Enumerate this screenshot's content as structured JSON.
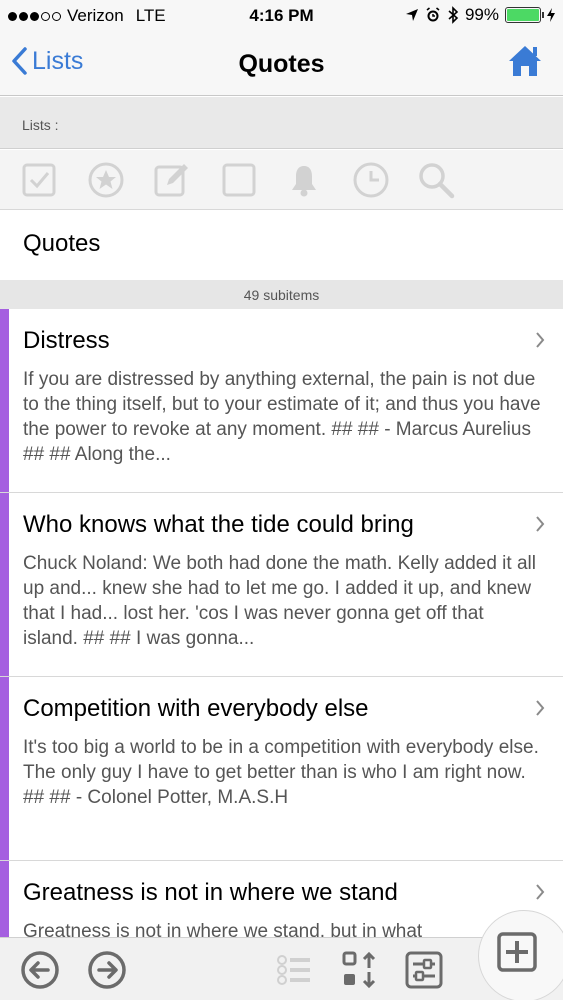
{
  "status_bar": {
    "carrier": "Verizon",
    "network": "LTE",
    "time": "4:16 PM",
    "battery_percent": "99%",
    "battery_level": 0.99
  },
  "nav": {
    "back_label": "Lists",
    "title": "Quotes"
  },
  "breadcrumb": {
    "label": "Lists :"
  },
  "toolbar": {
    "icons": [
      "checkbox-checked-icon",
      "star-circle-icon",
      "edit-icon",
      "checkbox-empty-icon",
      "bell-icon",
      "clock-icon",
      "search-icon"
    ]
  },
  "list": {
    "title": "Quotes",
    "subitems_count": "49 subitems"
  },
  "items": [
    {
      "title": "Distress",
      "description": "If you are distressed by anything external, the pain is not due to the thing itself, but to your estimate of it; and thus you have the power to revoke at any moment.  ##  ## - Marcus Aurelius ##  ## Along the..."
    },
    {
      "title": "Who knows what the tide could bring",
      "description": "Chuck Noland: We both had done the math. Kelly added it all up and... knew she had to let me go. I added it up, and knew that I had... lost her. 'cos I was never gonna get off that island.  ##  ## I was gonna..."
    },
    {
      "title": "Competition with everybody else",
      "description": "It's too big a world to be in a competition with everybody else. The only guy I have to get better than is who I am right now.  ##  ## - Colonel Potter, M.A.S.H"
    },
    {
      "title": "Greatness is not in where we stand",
      "description": "Greatness is not in where we stand, but in what"
    }
  ],
  "colors": {
    "accent": "#3a7bd5",
    "stripe": "#a55fe0",
    "icon_gray": "#6b6b6b",
    "toolbar_icon_faint": "#d2d2d2"
  }
}
